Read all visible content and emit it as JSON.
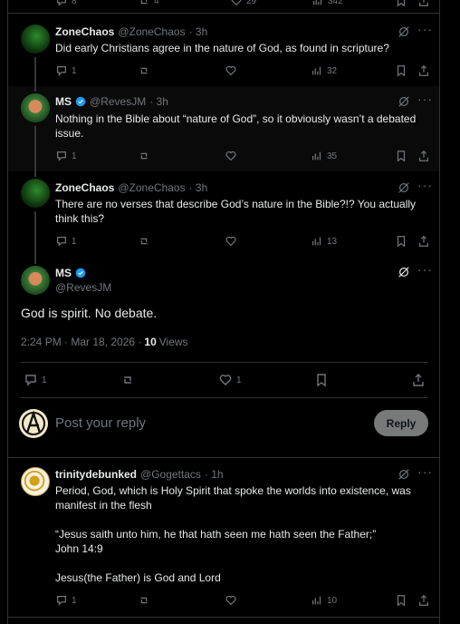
{
  "top_counts": [
    "8",
    "4",
    "29",
    "342"
  ],
  "tweets": [
    {
      "name": "ZoneChaos",
      "handle": "@ZoneChaos",
      "time": "· 3h",
      "text": "Did early Christians agree in the nature of God, as found in scripture?",
      "replies": "1",
      "views": "32"
    },
    {
      "name": "MS",
      "handle": "@RevesJM",
      "time": "· 3h",
      "text": "Nothing in the Bible about “nature of God”, so it obviously wasn’t a debated issue.",
      "replies": "1",
      "views": "35"
    },
    {
      "name": "ZoneChaos",
      "handle": "@ZoneChaos",
      "time": "· 3h",
      "text": "There are no verses that describe God’s nature in the Bible?!?  You actually think this?",
      "replies": "1",
      "views": "13"
    }
  ],
  "focus": {
    "name": "MS",
    "handle": "@RevesJM",
    "text": "God is spirit. No debate.",
    "timestamp": "2:24 PM · Mar 18, 2026 ·",
    "views_count": "10",
    "views_label": "Views",
    "replies": "1",
    "likes": "1"
  },
  "compose": {
    "placeholder": "Post your reply",
    "button": "Reply"
  },
  "reply": {
    "name": "trinitydebunked",
    "handle": "@Gogettacs",
    "time": "· 1h",
    "line1": "Period, God, which is Holy Spirit that spoke the worlds into existence, was manifest in the flesh",
    "line2": "“Jesus saith unto him, he that hath seen me hath seen the Father;”",
    "line3": "John 14:9",
    "line4": "Jesus(the Father) is God and Lord",
    "replies": "1",
    "views": "10"
  },
  "colors": {
    "accent": "#1d9bf0",
    "muted": "#71767b",
    "background": "#000000"
  }
}
